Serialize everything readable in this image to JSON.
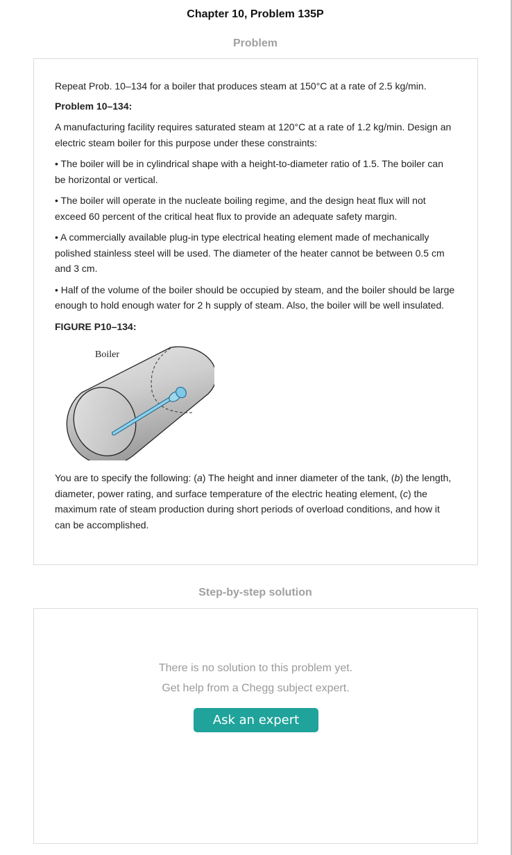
{
  "header": {
    "title": "Chapter 10, Problem 135P"
  },
  "problem": {
    "heading": "Problem",
    "intro": "Repeat Prob. 10–134 for a boiler that produces steam at 150°C at a rate of 2.5 kg/min.",
    "ref_label": "Problem 10–134:",
    "ref_text": "A manufacturing facility requires saturated steam at 120°C at a rate of 1.2 kg/min. Design an electric steam boiler for this purpose under these constraints:",
    "bullets": [
      "• The boiler will be in cylindrical shape with a height-to-diameter ratio of 1.5. The boiler can be horizontal or vertical.",
      "• The boiler will operate in the nucleate boiling regime, and the design heat flux will not exceed 60 percent of the critical heat flux to provide an adequate safety margin.",
      "• A commercially available plug-in type electrical heating element made of mechanically polished stainless steel will be used. The diameter of the heater cannot be between 0.5 cm and 3 cm.",
      "• Half of the volume of the boiler should be occupied by steam, and the boiler should be large enough to hold enough water for 2 h supply of steam. Also, the boiler will be well insulated."
    ],
    "figure_label": "FIGURE P10–134:",
    "figure_caption": "Boiler",
    "specify": {
      "lead": "You are to specify the following: (",
      "a": "a",
      "a_text": ") The height and inner diameter of the tank, (",
      "b": "b",
      "b_text": ") the length, diameter, power rating, and surface temperature of the electric heating element, (",
      "c": "c",
      "c_text": ") the maximum rate of steam production during short periods of overload conditions, and how it can be accomplished."
    }
  },
  "solution": {
    "heading": "Step-by-step solution",
    "no_solution": "There is no solution to this problem yet.",
    "help_text": "Get help from a Chegg subject expert.",
    "button_label": "Ask an expert"
  },
  "colors": {
    "accent": "#1fa39b",
    "heater": "#7ec8e8"
  }
}
